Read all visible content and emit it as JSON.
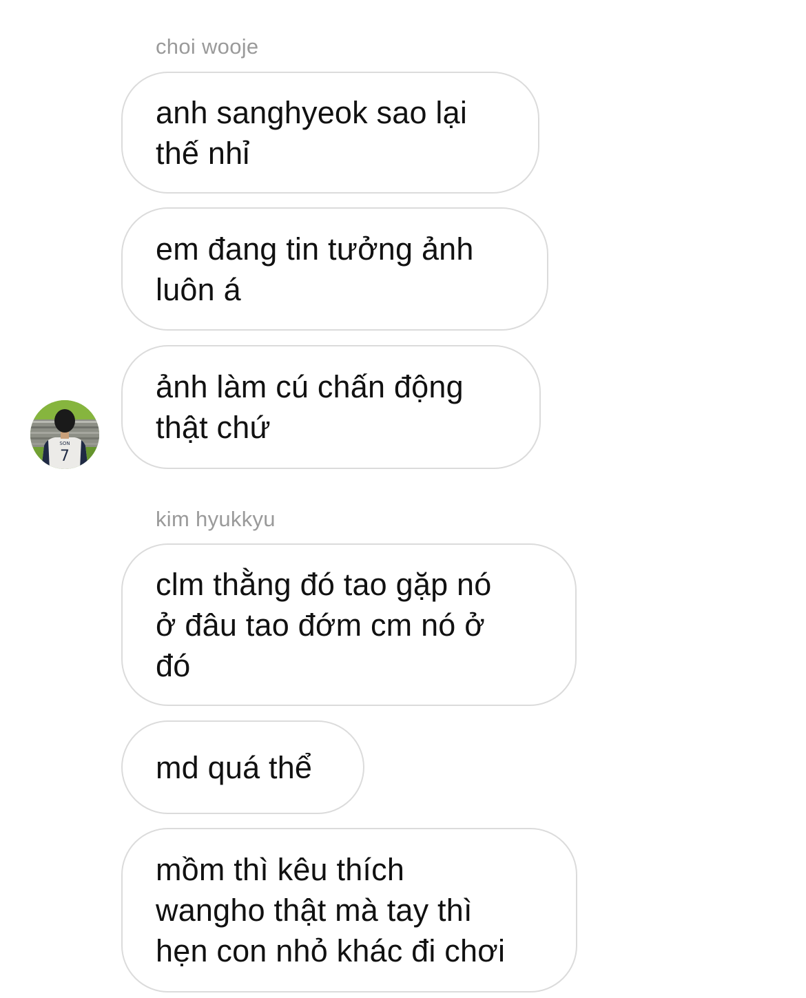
{
  "conversation": {
    "groups": [
      {
        "sender": "choi wooje",
        "messages": [
          "anh sanghyeok sao lại\nthế nhỉ",
          "em đang tin tưởng ảnh\nluôn á",
          "ảnh làm cú chấn động\nthật chứ"
        ]
      },
      {
        "sender": "kim hyukkyu",
        "messages": [
          "clm thằng đó tao gặp nó\nở đâu tao đớm cm nó ở\nđó",
          "md quá thể",
          "mồm thì kêu thích\nwangho thật mà tay thì\nhẹn con nhỏ khác đi chơi"
        ]
      }
    ],
    "avatar": {
      "icon": "profile-photo-avatar",
      "jersey_text": "SON",
      "jersey_number": "7"
    }
  },
  "colors": {
    "background": "#ffffff",
    "bubble_border": "#dbdbdb",
    "message_text": "#111111",
    "sender_name": "#9a9a9a"
  }
}
